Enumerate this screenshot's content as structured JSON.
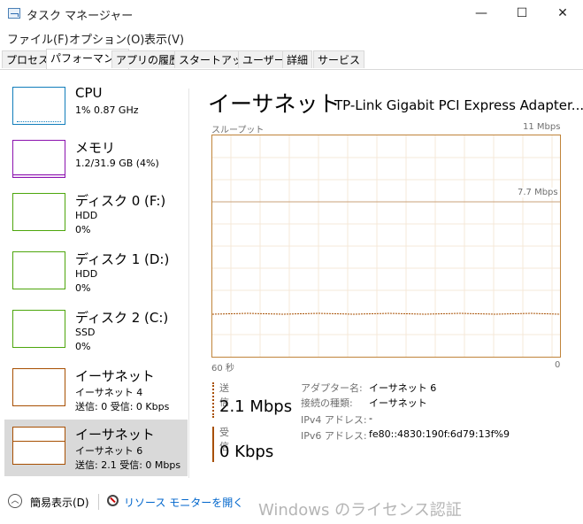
{
  "window": {
    "title": "タスク マネージャー",
    "minimize": "—",
    "maximize": "☐",
    "close": "✕"
  },
  "menu": [
    "ファイル(F)",
    "オプション(O)",
    "表示(V)"
  ],
  "tabs": [
    "プロセス",
    "パフォーマンス",
    "アプリの履歴",
    "スタートアップ",
    "ユーザー",
    "詳細",
    "サービス"
  ],
  "active_tab": "パフォーマンス",
  "sidebar": {
    "items": [
      {
        "name": "CPU",
        "line1": "1%  0.87 GHz",
        "line2": "",
        "color": "#117dbb"
      },
      {
        "name": "メモリ",
        "line1": "1.2/31.9 GB (4%)",
        "line2": "",
        "color": "#8b12ae"
      },
      {
        "name": "ディスク 0 (F:)",
        "line1": "HDD",
        "line2": "0%",
        "color": "#4da60c"
      },
      {
        "name": "ディスク 1 (D:)",
        "line1": "HDD",
        "line2": "0%",
        "color": "#4da60c"
      },
      {
        "name": "ディスク 2 (C:)",
        "line1": "SSD",
        "line2": "0%",
        "color": "#4da60c"
      },
      {
        "name": "イーサネット",
        "line1": "イーサネット 4",
        "line2": "送信: 0  受信: 0 Kbps",
        "color": "#a74f01"
      },
      {
        "name": "イーサネット",
        "line1": "イーサネット 6",
        "line2": "送信: 2.1  受信: 0 Mbps",
        "color": "#a74f01"
      }
    ],
    "selected_index": 6
  },
  "main": {
    "title": "イーサネット",
    "adapter": "TP-Link Gigabit PCI Express Adapter...",
    "graph": {
      "label": "スループット",
      "max_label": "11 Mbps",
      "mid_label": "7.7 Mbps",
      "time_left": "60 秒",
      "time_right": "0",
      "color": "#a74f01"
    },
    "send": {
      "label": "送信",
      "value": "2.1 Mbps"
    },
    "receive": {
      "label": "受信",
      "value": "0 Kbps"
    },
    "details": [
      {
        "key": "アダプター名:",
        "value": "イーサネット 6"
      },
      {
        "key": "接続の種類:",
        "value": "イーサネット"
      },
      {
        "key": "IPv4 アドレス:",
        "value": "-"
      },
      {
        "key": "IPv6 アドレス:",
        "value": "fe80::4830:190f:6d79:13f%9"
      }
    ]
  },
  "footer": {
    "fewer_details": "簡易表示(D)",
    "resource_monitor": "リソース モニターを開く"
  },
  "watermark": "Windows のライセンス認証"
}
